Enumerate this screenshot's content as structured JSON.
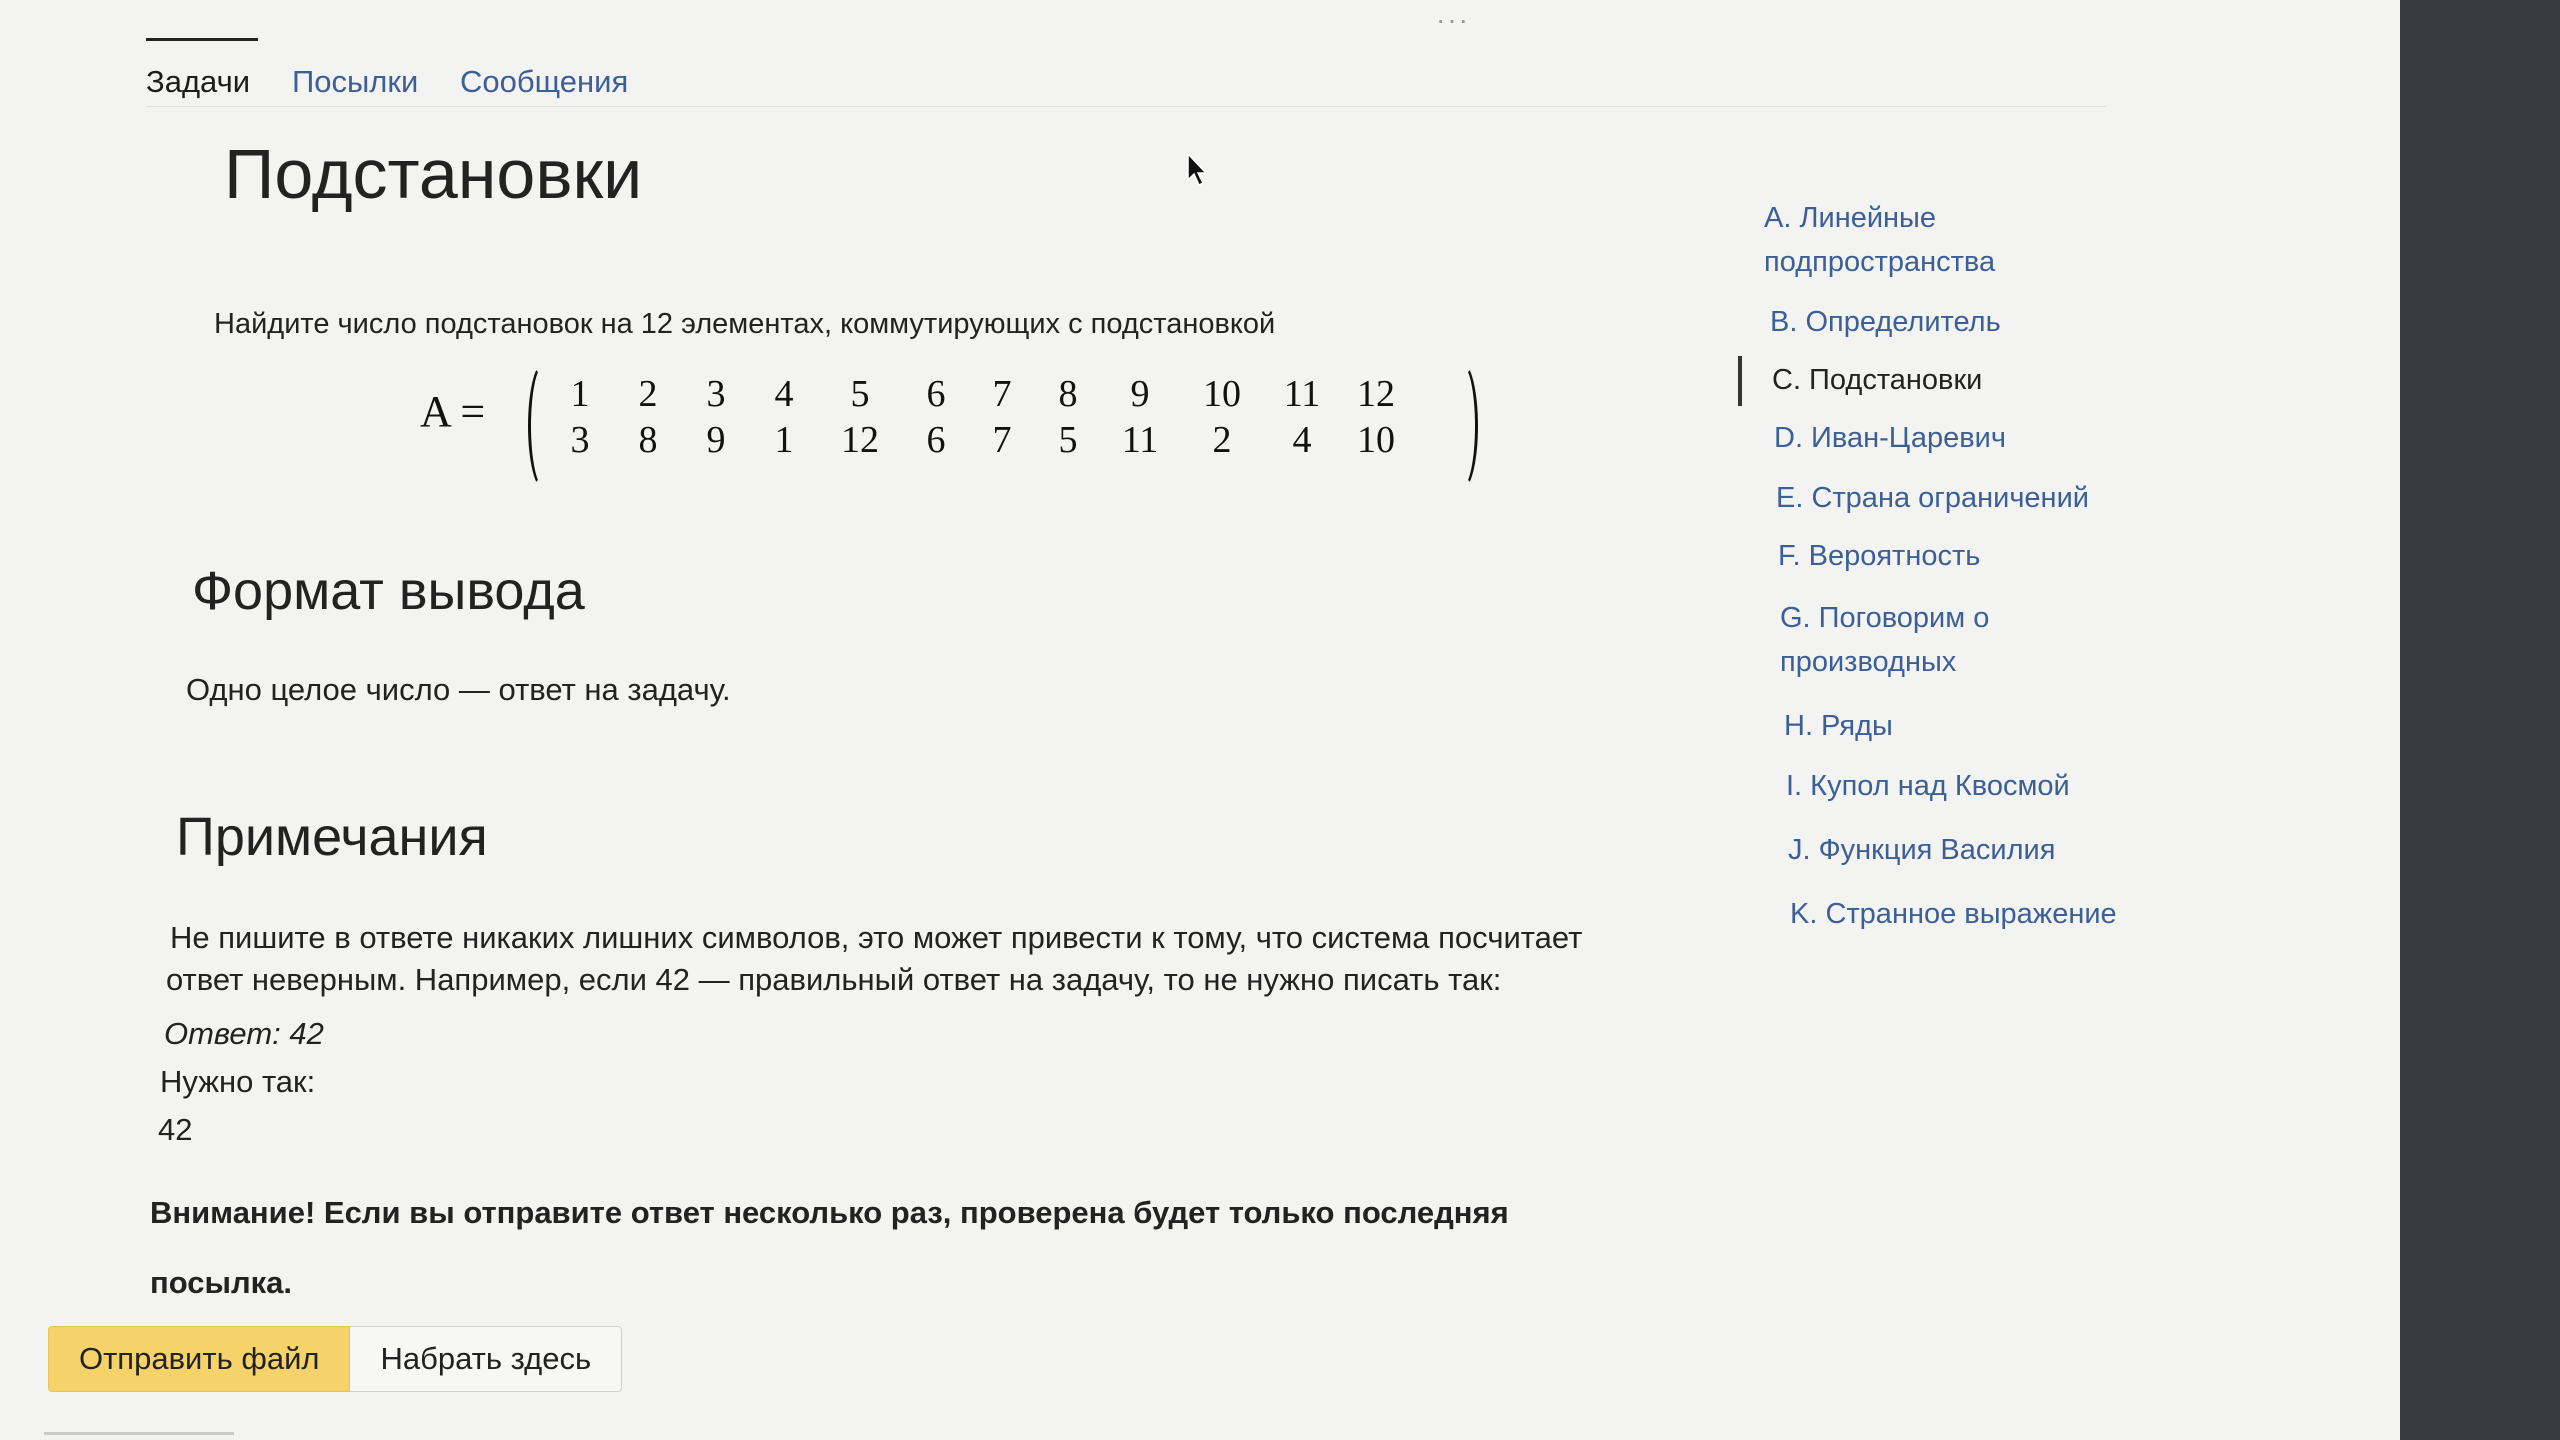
{
  "tabs": [
    "Задачи",
    "Посылки",
    "Сообщения"
  ],
  "title": "Подстановки",
  "statement": "Найдите число подстановок на 12 элементах, коммутирующих с подстановкой",
  "formula": {
    "lhs": "A =",
    "top": [
      "1",
      "2",
      "3",
      "4",
      "5",
      "6",
      "7",
      "8",
      "9",
      "10",
      "11",
      "12"
    ],
    "bottom": [
      "3",
      "8",
      "9",
      "1",
      "12",
      "6",
      "7",
      "5",
      "11",
      "2",
      "4",
      "10"
    ]
  },
  "output_format": {
    "heading": "Формат вывода",
    "text": "Одно целое число — ответ на задачу."
  },
  "notes": {
    "heading": "Примечания",
    "line1": "Не пишите в ответе никаких лишних символов, это может привести к тому, что система посчитает",
    "line2": "ответ неверным. Например, если 42 — правильный ответ на задачу, то не нужно писать так:",
    "example_wrong": "Ответ: 42",
    "need": "Нужно так:",
    "example_right": "42"
  },
  "warning": "Внимание! Если вы отправите ответ несколько раз, проверена будет только последняя посылка.",
  "buttons": {
    "submit_file": "Отправить файл",
    "type_here": "Набрать здесь"
  },
  "sidebar": [
    {
      "label": "A. Линейные подпространства"
    },
    {
      "label": "B. Определитель"
    },
    {
      "label": "C. Подстановки",
      "active": true
    },
    {
      "label": "D. Иван-Царевич"
    },
    {
      "label": "E. Страна ограничений"
    },
    {
      "label": "F. Вероятность"
    },
    {
      "label": "G. Поговорим о производных"
    },
    {
      "label": "H. Ряды"
    },
    {
      "label": "I. Купол над Квосмой"
    },
    {
      "label": "J. Функция Василия"
    },
    {
      "label": "K. Странное выражение"
    }
  ],
  "colors": {
    "link": "#3b5f96",
    "button_primary": "#f5d36a",
    "page_bg": "#f3f3f1"
  }
}
